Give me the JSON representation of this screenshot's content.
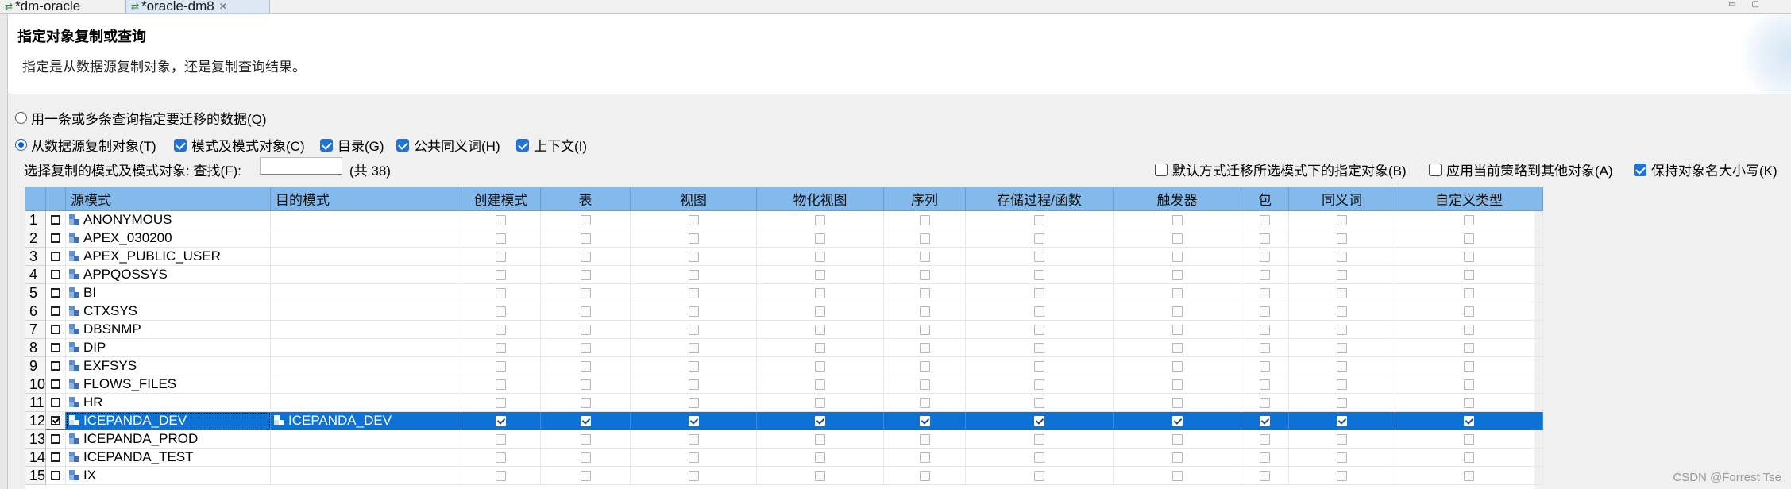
{
  "tabs": [
    {
      "label": "*dm-oracle"
    },
    {
      "label": "*oracle-dm8"
    }
  ],
  "header": {
    "title": "指定对象复制或查询",
    "description": "指定是从数据源复制对象，还是复制查询结果。"
  },
  "options": {
    "query_radio": "用一条或多条查询指定要迁移的数据(Q)",
    "copy_radio": "从数据源复制对象(T)",
    "schema_objects": "模式及模式对象(C)",
    "catalog": "目录(G)",
    "public_synonym": "公共同义词(H)",
    "context": "上下文(I)",
    "default_migrate": "默认方式迁移所选模式下的指定对象(B)",
    "apply_strategy": "应用当前策略到其他对象(A)",
    "keep_case": "保持对象名大小写(K)"
  },
  "search": {
    "label": "选择复制的模式及模式对象: 查找(F):",
    "value": "",
    "count": "(共 38)"
  },
  "table": {
    "columns": [
      "源模式",
      "目的模式",
      "创建模式",
      "表",
      "视图",
      "物化视图",
      "序列",
      "存储过程/函数",
      "触发器",
      "包",
      "同义词",
      "自定义类型"
    ],
    "rows": [
      {
        "num": "1",
        "source": "ANONYMOUS",
        "target": "",
        "selected": false
      },
      {
        "num": "2",
        "source": "APEX_030200",
        "target": "",
        "selected": false
      },
      {
        "num": "3",
        "source": "APEX_PUBLIC_USER",
        "target": "",
        "selected": false
      },
      {
        "num": "4",
        "source": "APPQOSSYS",
        "target": "",
        "selected": false
      },
      {
        "num": "5",
        "source": "BI",
        "target": "",
        "selected": false
      },
      {
        "num": "6",
        "source": "CTXSYS",
        "target": "",
        "selected": false
      },
      {
        "num": "7",
        "source": "DBSNMP",
        "target": "",
        "selected": false
      },
      {
        "num": "8",
        "source": "DIP",
        "target": "",
        "selected": false
      },
      {
        "num": "9",
        "source": "EXFSYS",
        "target": "",
        "selected": false
      },
      {
        "num": "10",
        "source": "FLOWS_FILES",
        "target": "",
        "selected": false
      },
      {
        "num": "11",
        "source": "HR",
        "target": "",
        "selected": false
      },
      {
        "num": "12",
        "source": "ICEPANDA_DEV",
        "target": "ICEPANDA_DEV",
        "selected": true
      },
      {
        "num": "13",
        "source": "ICEPANDA_PROD",
        "target": "",
        "selected": false
      },
      {
        "num": "14",
        "source": "ICEPANDA_TEST",
        "target": "",
        "selected": false
      },
      {
        "num": "15",
        "source": "IX",
        "target": "",
        "selected": false
      }
    ]
  },
  "watermark": "CSDN @Forrest Tse",
  "colors": {
    "header_bg": "#84b9ec",
    "selection": "#0e72d5",
    "checkbox_accent": "#1e73d8"
  }
}
